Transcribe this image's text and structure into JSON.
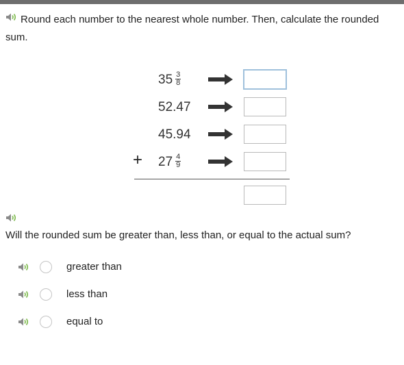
{
  "instructions": "Round each number to the nearest whole number. Then, calculate the rounded sum.",
  "problem": {
    "rows": [
      {
        "whole": "35",
        "numerator": "3",
        "denominator": "8"
      },
      {
        "whole": "52.47"
      },
      {
        "whole": "45.94"
      },
      {
        "whole": "27",
        "numerator": "4",
        "denominator": "9"
      }
    ],
    "operator": "+",
    "answer_fields": [
      "",
      "",
      "",
      ""
    ],
    "sum_field": ""
  },
  "question": "Will the rounded sum be greater than, less than, or equal to the actual sum?",
  "options": [
    {
      "label": "greater than",
      "selected": false
    },
    {
      "label": "less than",
      "selected": false
    },
    {
      "label": "equal to",
      "selected": false
    }
  ],
  "icons": {
    "speaker": "speaker-icon",
    "arrow": "right-arrow-icon"
  },
  "colors": {
    "topbar": "#6e6e6e",
    "speaker": "#8a8a8a",
    "speaker_wave": "#7bb84a",
    "focus_border": "#9fc0dc"
  }
}
